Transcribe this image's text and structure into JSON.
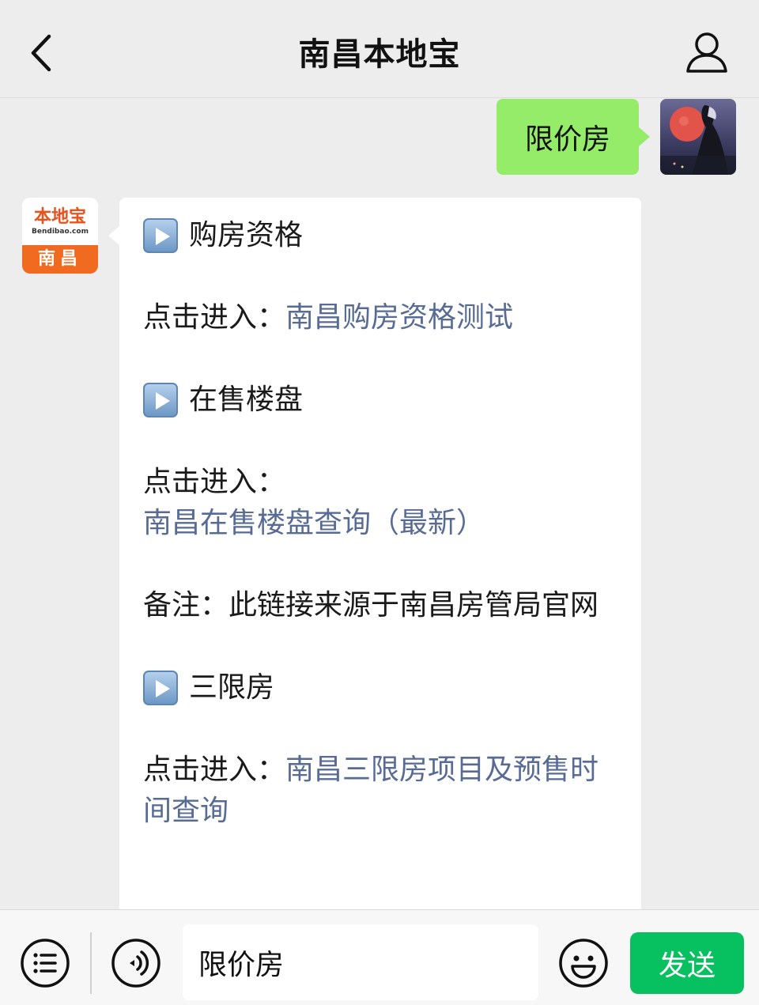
{
  "header": {
    "title": "南昌本地宝"
  },
  "user_message": {
    "text": "限价房"
  },
  "bot_avatar": {
    "logo_text": "本地宝",
    "logo_sub": "Bendibao.com",
    "city": "南昌"
  },
  "bot_message": {
    "sections": [
      {
        "heading": "购房资格",
        "prefix": "点击进入：",
        "link": "南昌购房资格测试"
      },
      {
        "heading": "在售楼盘",
        "prefix": "点击进入：",
        "link": "南昌在售楼盘查询（最新）",
        "note": "备注：此链接来源于南昌房管局官网"
      },
      {
        "heading": "三限房",
        "prefix": "点击进入：",
        "link": "南昌三限房项目及预售时间查询"
      }
    ]
  },
  "input_bar": {
    "input_value": "限价房",
    "send_label": "发送"
  },
  "colors": {
    "user_bubble": "#95ec69",
    "link": "#576b95",
    "send_button": "#07c160"
  }
}
